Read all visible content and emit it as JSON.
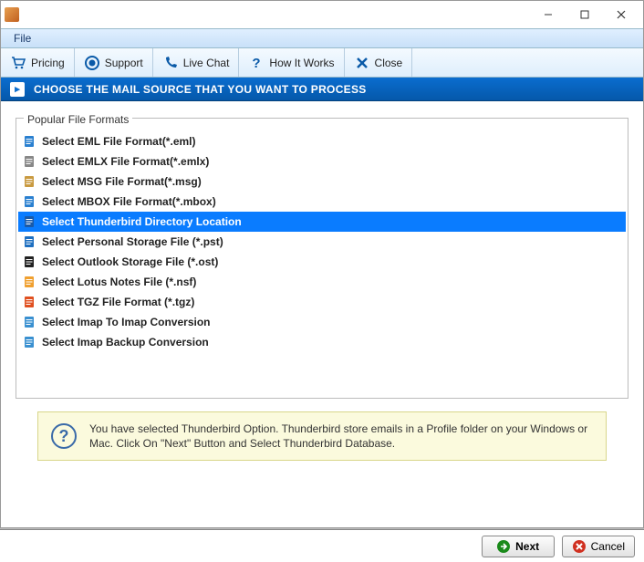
{
  "menubar": {
    "file": "File"
  },
  "toolbar": {
    "pricing": "Pricing",
    "support": "Support",
    "livechat": "Live Chat",
    "howitworks": "How It Works",
    "close": "Close"
  },
  "banner": {
    "text": "CHOOSE THE MAIL SOURCE THAT YOU WANT TO PROCESS"
  },
  "group": {
    "legend": "Popular File Formats"
  },
  "formats": [
    {
      "label": "Select EML File Format(*.eml)",
      "icon_color": "#2a80d0",
      "selected": false
    },
    {
      "label": "Select EMLX File Format(*.emlx)",
      "icon_color": "#888",
      "selected": false
    },
    {
      "label": "Select MSG File Format(*.msg)",
      "icon_color": "#c99a40",
      "selected": false
    },
    {
      "label": "Select MBOX File Format(*.mbox)",
      "icon_color": "#2a80d0",
      "selected": false
    },
    {
      "label": "Select Thunderbird Directory Location",
      "icon_color": "#1a5aa8",
      "selected": true
    },
    {
      "label": "Select Personal Storage File (*.pst)",
      "icon_color": "#1e6fc0",
      "selected": false
    },
    {
      "label": "Select Outlook Storage File (*.ost)",
      "icon_color": "#222",
      "selected": false
    },
    {
      "label": "Select Lotus Notes File (*.nsf)",
      "icon_color": "#f0a030",
      "selected": false
    },
    {
      "label": "Select TGZ File Format (*.tgz)",
      "icon_color": "#e05020",
      "selected": false
    },
    {
      "label": "Select Imap To Imap Conversion",
      "icon_color": "#3a90d0",
      "selected": false
    },
    {
      "label": "Select Imap Backup Conversion",
      "icon_color": "#3a90d0",
      "selected": false
    }
  ],
  "info": {
    "text": "You have selected Thunderbird Option. Thunderbird store emails in a Profile folder on your Windows or Mac. Click On \"Next\" Button and Select Thunderbird Database."
  },
  "footer": {
    "next": "Next",
    "cancel": "Cancel"
  }
}
